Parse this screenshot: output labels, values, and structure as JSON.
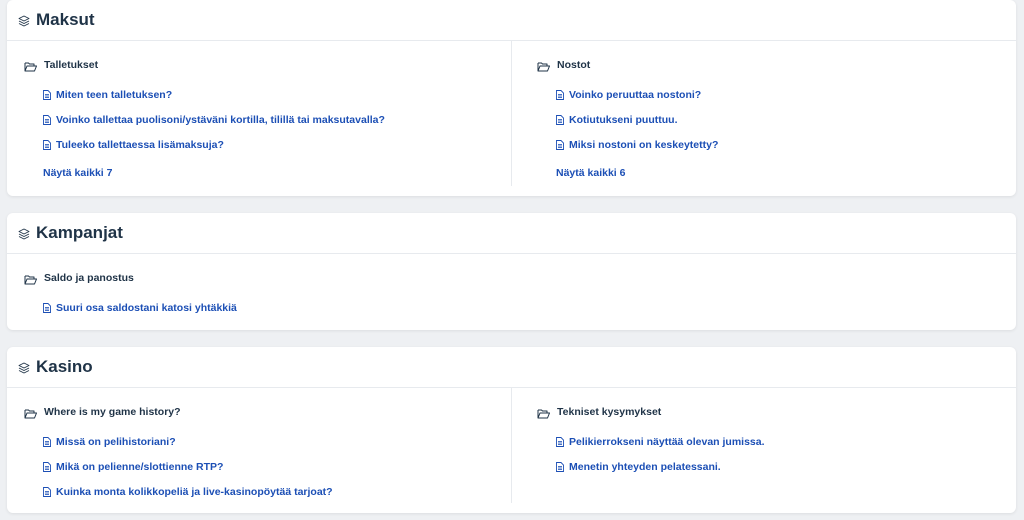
{
  "sections": [
    {
      "title": "Maksut",
      "columns": [
        {
          "folder": "Talletukset",
          "articles": [
            "Miten teen talletuksen?",
            "Voinko tallettaa puolisoni/ystäväni kortilla, tilillä tai maksutavalla?",
            "Tuleeko tallettaessa lisämaksuja?"
          ],
          "show_all": "Näytä kaikki 7"
        },
        {
          "folder": "Nostot",
          "articles": [
            "Voinko peruuttaa nostoni?",
            "Kotiutukseni puuttuu.",
            "Miksi nostoni on keskeytetty?"
          ],
          "show_all": "Näytä kaikki 6"
        }
      ]
    },
    {
      "title": "Kampanjat",
      "columns": [
        {
          "folder": "Saldo ja panostus",
          "articles": [
            "Suuri osa saldostani katosi yhtäkkiä"
          ]
        }
      ]
    },
    {
      "title": "Kasino",
      "columns": [
        {
          "folder": "Where is my game history?",
          "articles": [
            "Missä on pelihistoriani?",
            "Mikä on pelienne/slottienne RTP?",
            "Kuinka monta kolikkopeliä ja live-kasinopöytää tarjoat?"
          ]
        },
        {
          "folder": "Tekniset kysymykset",
          "articles": [
            "Pelikierrokseni näyttää olevan jumissa.",
            "Menetin yhteyden pelatessani."
          ]
        }
      ]
    }
  ],
  "colors": {
    "background": "#eef0f3",
    "heading": "#1f3347",
    "link": "#1c4fb5",
    "divider": "#e7eaee"
  },
  "icons": {
    "section": "layers-icon",
    "folder": "folder-open-icon",
    "article": "document-icon"
  }
}
